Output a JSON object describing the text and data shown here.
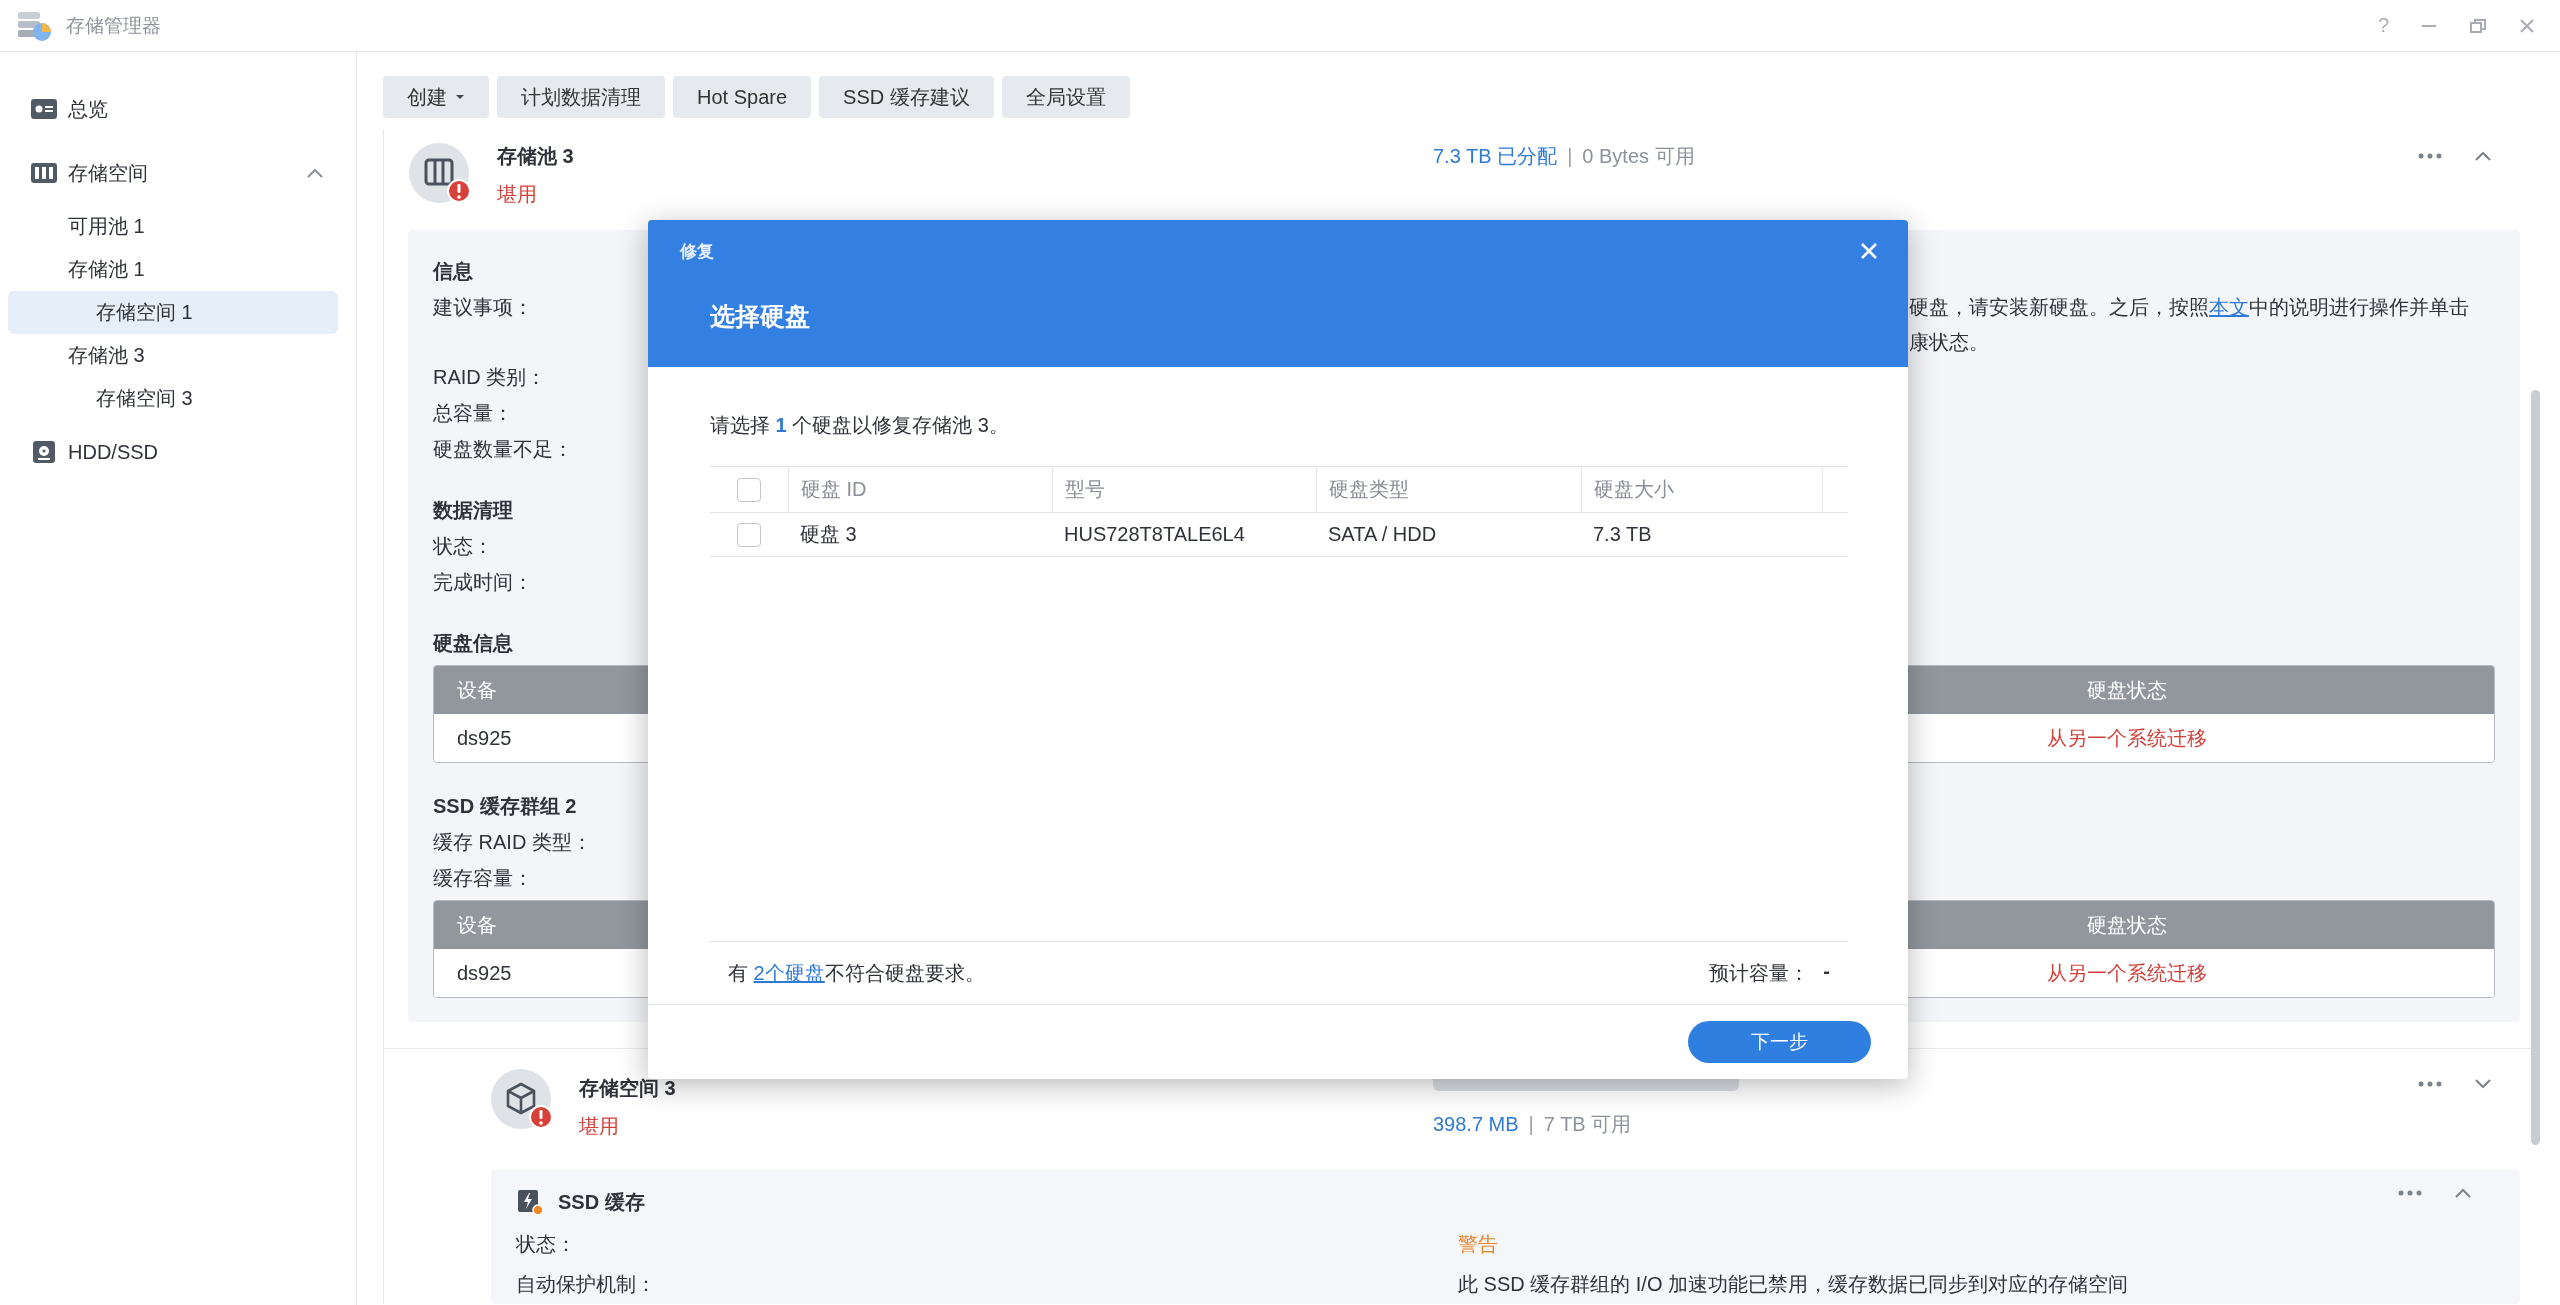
{
  "window": {
    "title": "存储管理器",
    "help": "?"
  },
  "sidebar": {
    "items": [
      {
        "label": "总览",
        "selected": false
      },
      {
        "label": "存储空间",
        "selected": false,
        "expanded": true,
        "children": [
          {
            "label": "可用池 1",
            "selected": false
          },
          {
            "label": "存储池 1",
            "selected": false,
            "children": [
              {
                "label": "存储空间 1",
                "selected": true
              }
            ]
          },
          {
            "label": "存储池 3",
            "selected": false,
            "children": [
              {
                "label": "存储空间 3",
                "selected": false
              }
            ]
          }
        ]
      },
      {
        "label": "HDD/SSD",
        "selected": false
      }
    ]
  },
  "toolbar": [
    {
      "label": "创建",
      "has_menu": true
    },
    {
      "label": "计划数据清理",
      "has_menu": false
    },
    {
      "label": "Hot Spare",
      "has_menu": false
    },
    {
      "label": "SSD 缓存建议",
      "has_menu": false
    },
    {
      "label": "全局设置",
      "has_menu": false
    }
  ],
  "pool": {
    "name": "存储池 3",
    "status": "堪用",
    "allocated": "7.3 TB 已分配",
    "separator": "|",
    "available": "0 Bytes 可用",
    "expanded": true,
    "sections": [
      {
        "heading": "信息",
        "rows": [
          {
            "label": "建议事项：",
            "note": {
              "before": "硬盘，请安装新硬盘。之后，按照",
              "link": "本文",
              "after": "中的说明进行操作并单击",
              "continued": "康状态。"
            }
          },
          {
            "label": "RAID 类别："
          },
          {
            "label": "总容量："
          },
          {
            "label": "硬盘数量不足："
          }
        ]
      },
      {
        "heading": "数据清理",
        "rows": [
          {
            "label": "状态："
          },
          {
            "label": "完成时间："
          }
        ]
      },
      {
        "heading": "硬盘信息",
        "table": {
          "columns": [
            "设备",
            "硬盘状态"
          ],
          "rows": [
            [
              "ds925",
              "从另一个系统迁移"
            ]
          ]
        }
      },
      {
        "heading": "SSD 缓存群组 2",
        "rows": [
          {
            "label": "缓存 RAID 类型："
          },
          {
            "label": "缓存容量："
          }
        ],
        "table": {
          "columns": [
            "设备",
            "硬盘状态"
          ],
          "rows": [
            [
              "ds925",
              "从另一个系统迁移"
            ]
          ]
        }
      }
    ]
  },
  "volume": {
    "name": "存储空间 3",
    "status": "堪用",
    "used": "398.7 MB",
    "separator": "|",
    "available": "7 TB 可用",
    "expanded": false,
    "cache": {
      "title": "SSD 缓存",
      "expanded": true,
      "rows": [
        {
          "label": "状态：",
          "value": "警告",
          "kind": "warning"
        },
        {
          "label": "自动保护机制：",
          "value": "此 SSD 缓存群组的 I/O 加速功能已禁用，缓存数据已同步到对应的存储空间",
          "kind": "plain"
        }
      ]
    }
  },
  "modal": {
    "caption": "修复",
    "title": "选择硬盘",
    "prompt": "请选择 **1** 个硬盘以修复存储池 3。",
    "all_checked": false,
    "columns": [
      "硬盘 ID",
      "型号",
      "硬盘类型",
      "硬盘大小"
    ],
    "rows": [
      {
        "checked": false,
        "cells": [
          "硬盘 3",
          "HUS728T8TALE6L4",
          "SATA / HDD",
          "7.3 TB"
        ]
      }
    ],
    "note": {
      "before": "有 ",
      "link": "2个硬盘",
      "after": "不符合硬盘要求。"
    },
    "estimate_label": "预计容量：",
    "estimate_value": "-",
    "next_button": "下一步"
  }
}
